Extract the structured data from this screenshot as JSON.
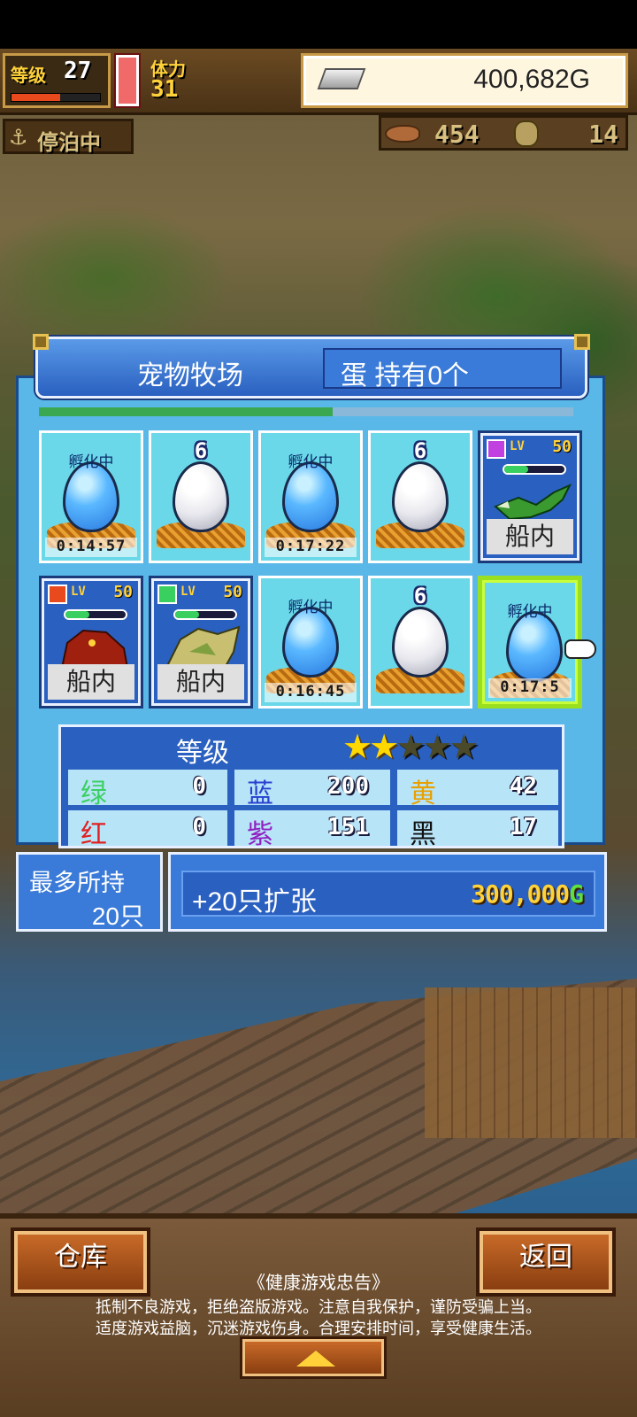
{
  "header": {
    "level_label": "等级",
    "level_value": "27",
    "level_progress": 0.55,
    "stamina_label": "体力",
    "stamina_value": "31",
    "gold_value": "400,682G",
    "docked_label": "停泊中",
    "meat_value": "454",
    "medal_value": "14"
  },
  "ranch": {
    "title": "宠物牧场",
    "egg_count": "蛋 持有0个",
    "progress": 0.55,
    "slots": [
      {
        "kind": "hatching",
        "label": "孵化中",
        "timer": "0:14:57"
      },
      {
        "kind": "egg",
        "count": "6"
      },
      {
        "kind": "hatching",
        "label": "孵化中",
        "timer": "0:17:22"
      },
      {
        "kind": "egg",
        "count": "6"
      },
      {
        "kind": "pet",
        "lv": "LV",
        "level": "50",
        "location": "船内",
        "element": "purple"
      },
      {
        "kind": "pet",
        "lv": "LV",
        "level": "50",
        "location": "船内",
        "element": "fire"
      },
      {
        "kind": "pet",
        "lv": "LV",
        "level": "50",
        "location": "船内",
        "element": "green"
      },
      {
        "kind": "hatching",
        "label": "孵化中",
        "timer": "0:16:45"
      },
      {
        "kind": "egg",
        "count": "6"
      },
      {
        "kind": "hatching",
        "label": "孵化中",
        "timer": "0:17:5"
      }
    ]
  },
  "stats": {
    "title": "等级",
    "stars_filled": 2,
    "stars_total": 5,
    "items": [
      {
        "name": "绿",
        "value": "0",
        "color": "#3ad060"
      },
      {
        "name": "蓝",
        "value": "200",
        "color": "#2a40d0"
      },
      {
        "name": "黄",
        "value": "42",
        "color": "#e8a000"
      },
      {
        "name": "红",
        "value": "0",
        "color": "#e02020"
      },
      {
        "name": "紫",
        "value": "151",
        "color": "#9020c0"
      },
      {
        "name": "黑",
        "value": "17",
        "color": "#111111"
      }
    ]
  },
  "capacity": {
    "label": "最多所持",
    "value": "20只",
    "expand_label": "+20只扩张",
    "expand_price": "300,000",
    "expand_currency": "G"
  },
  "footer": {
    "warehouse": "仓库",
    "back": "返回",
    "notice_title": "《健康游戏忠告》",
    "notice_line1": "抵制不良游戏，拒绝盗版游戏。注意自我保护，谨防受骗上当。",
    "notice_line2": "适度游戏益脑，沉迷游戏伤身。合理安排时间，享受健康生活。"
  }
}
